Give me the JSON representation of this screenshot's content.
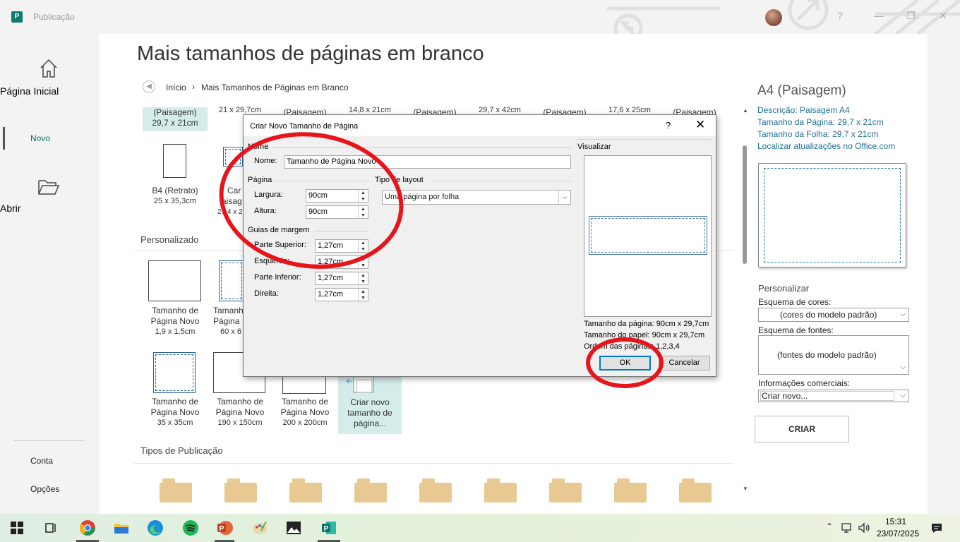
{
  "app": {
    "title": "Publicação"
  },
  "nav": {
    "home": "Página Inicial",
    "new": "Novo",
    "open": "Abrir",
    "account": "Conta",
    "options": "Opções"
  },
  "main": {
    "title": "Mais tamanhos de páginas em branco",
    "breadcrumb": {
      "home": "Início",
      "separator": "›",
      "current": "Mais Tamanhos de Páginas em Branco"
    },
    "top_row": [
      {
        "name": "(Paisagem)",
        "size": "29,7 x 21cm"
      },
      {
        "name": "",
        "size": "21 x 29,7cm"
      },
      {
        "name": "(Paisagem)",
        "size": ""
      },
      {
        "name": "",
        "size": "14,8 x 21cm"
      },
      {
        "name": "(Paisagem)",
        "size": ""
      },
      {
        "name": "",
        "size": "29,7 x 42cm"
      },
      {
        "name": "(Paisagem)",
        "size": ""
      },
      {
        "name": "",
        "size": "17,6 x 25cm"
      },
      {
        "name": "(Paisagem)",
        "size": ""
      }
    ],
    "row2": [
      {
        "name": "B4 (Retrato)",
        "size": "25 x 35,3cm"
      },
      {
        "name": "Car",
        "name2": "aisag",
        "size": "27,4 x 2"
      }
    ],
    "custom_title": "Personalizado",
    "custom_row1": [
      {
        "name": "Tamanho de Página Novo",
        "size": "1,9 x 1,5cm"
      },
      {
        "name": "Tamanh Página",
        "size": "60 x 6"
      }
    ],
    "custom_row2": [
      {
        "name": "Tamanho de Página Novo",
        "size": "35 x 35cm"
      },
      {
        "name": "Tamanho de Página Novo",
        "size": "190 x 150cm"
      },
      {
        "name": "Tamanho de Página Novo",
        "size": "200 x 200cm"
      },
      {
        "name": "Criar novo tamanho de página...",
        "size": ""
      }
    ],
    "pub_types_title": "Tipos de Publicação"
  },
  "right": {
    "title": "A4 (Paisagem)",
    "description": "Descrição: Paisagem A4",
    "page_size": "Tamanho da Página: 29,7 x 21cm",
    "sheet_size": "Tamanho da Folha: 29,7 x 21cm",
    "updates_link": "Localizar atualizações no Office.com",
    "personalize": "Personalizar",
    "color_label": "Esquema de cores:",
    "color_value": "(cores do modelo padrão)",
    "font_label": "Esquema de fontes:",
    "font_value": "(fontes do modelo padrão)",
    "info_label": "Informações comerciais:",
    "info_value": "Criar novo...",
    "create_button": "CRIAR"
  },
  "dialog": {
    "title": "Criar Novo Tamanho de Página",
    "help": "?",
    "close": "✕",
    "name_group": "Nome",
    "name_label": "Nome:",
    "name_value": "Tamanho de Página Novo",
    "page_group": "Página",
    "width_label": "Largura:",
    "width_value": "90cm",
    "height_label": "Altura:",
    "height_value": "90cm",
    "layout_group": "Tipo de layout",
    "layout_value": "Uma página por folha",
    "margin_group": "Guias de margem",
    "top_label": "Parte Superior:",
    "top_value": "1,27cm",
    "left_label": "Esquerda:",
    "left_value": "1,27cm",
    "bottom_label": "Parte Inferior:",
    "bottom_value": "1,27cm",
    "right_label": "Direita:",
    "right_value": "1,27cm",
    "preview_group": "Visualizar",
    "pv_page_size": "Tamanho da página: 90cm x 29,7cm",
    "pv_paper_size": "Tamanho do papel: 90cm x 29,7cm",
    "pv_order": "Ordem das páginas: 1,2,3,4",
    "ok": "OK",
    "cancel": "Cancelar"
  },
  "taskbar": {
    "time": "15:31",
    "date": "23/07/2025"
  }
}
